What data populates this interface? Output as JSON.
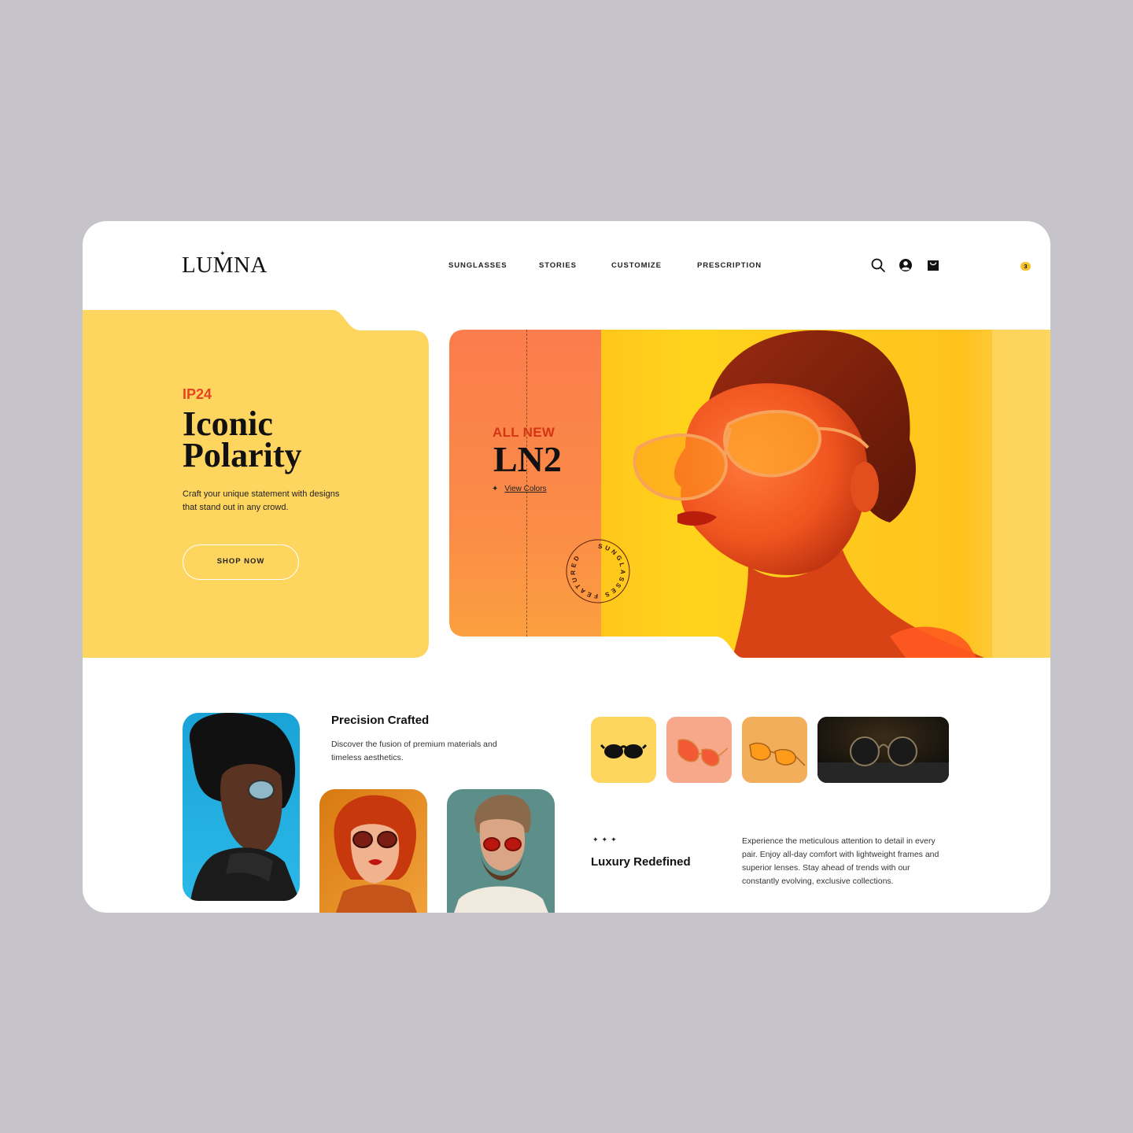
{
  "brand": {
    "logo_text": "LUMNA",
    "logo_mark": "✦"
  },
  "nav": {
    "items": [
      {
        "label": "SUNGLASSES"
      },
      {
        "label": "STORIES"
      },
      {
        "label": "CUSTOMIZE"
      },
      {
        "label": "PRESCRIPTION"
      }
    ],
    "icons": [
      "search-icon",
      "user-icon",
      "cart-icon"
    ],
    "cart_count": "3"
  },
  "hero": {
    "eyebrow": "IP24",
    "title_line1": "Iconic",
    "title_line2": "Polarity",
    "description": "Craft your unique statement with designs that stand out in any crowd.",
    "cta_label": "SHOP NOW"
  },
  "feature": {
    "kicker": "ALL NEW",
    "model": "LN2",
    "link_icon": "✦",
    "link_label": "View Colors",
    "badge_text": "SUNGLASSES FEATURED"
  },
  "precision": {
    "title": "Precision Crafted",
    "text": "Discover the fusion of premium materials and timeless aesthetics."
  },
  "luxury": {
    "stars": "✦✦✦",
    "title": "Luxury Redefined",
    "text": "Experience the meticulous attention to detail in every pair. Enjoy all-day comfort with lightweight frames and superior lenses. Stay ahead of trends with our constantly evolving, exclusive collections."
  },
  "colors": {
    "background": "#c6c3cb",
    "yellow": "#fdd55f",
    "accent_red": "#e64422",
    "orange": "#fb7f4c",
    "badge": "#f6c230"
  }
}
